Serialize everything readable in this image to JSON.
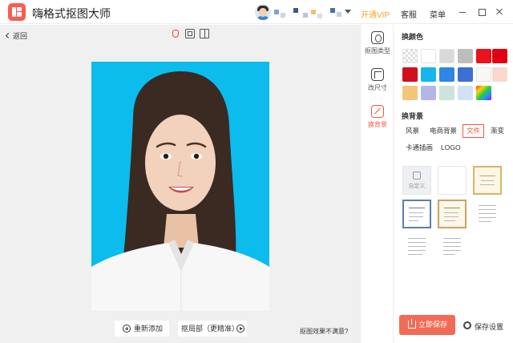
{
  "app": {
    "title": "嗨格式抠图大师"
  },
  "header": {
    "vip_label": "开通VIP",
    "service_label": "客服",
    "menu_label": "菜单"
  },
  "toolbar": {
    "back_label": "返回"
  },
  "canvas": {
    "readd_label": "重新添加",
    "refine_label": "抠局部（更精准）",
    "feedback_label": "抠图效果不满意?"
  },
  "rail": {
    "items": [
      {
        "label": "抠图类型",
        "icon": "ring-icon"
      },
      {
        "label": "改尺寸",
        "icon": "resize-icon"
      },
      {
        "label": "换背景",
        "icon": "background-icon",
        "active": true
      }
    ]
  },
  "panel": {
    "color_title": "换颜色",
    "colors": [
      "transparent",
      "#ffffff",
      "#d9d9d9",
      "#bdbdbd",
      "#e8131b",
      "#e00012",
      "#d10f1f",
      "#16b6ec",
      "#2f86e6",
      "#3d6fd4",
      "#f7f7f7",
      "#f9d9cf",
      "#f3c677",
      "#b4b6e6",
      "#cde3dc",
      "#cfe3f4",
      "rainbow"
    ],
    "background_title": "换背景",
    "tabs": [
      "风景",
      "电商背景",
      "文件",
      "渐变",
      "卡通插画",
      "LOGO"
    ],
    "active_tab": "文件",
    "custom_label": "自定义",
    "save_label": "立即保存",
    "settings_label": "保存设置"
  }
}
